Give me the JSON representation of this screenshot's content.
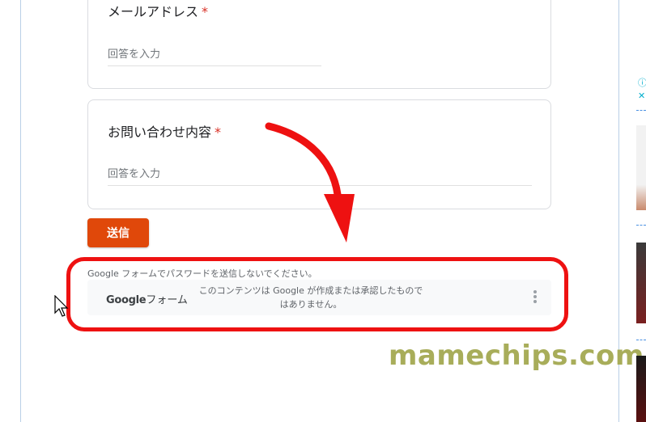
{
  "form": {
    "email_question": {
      "label": "メールアドレス",
      "required_mark": "*",
      "placeholder": "回答を入力"
    },
    "inquiry_question": {
      "label": "お問い合わせ内容",
      "required_mark": "*",
      "placeholder": "回答を入力"
    },
    "submit_label": "送信",
    "password_warning": "Google フォームでパスワードを送信しないでください。",
    "footer": {
      "brand_google": "Google",
      "brand_forms": "フォーム",
      "disclaimer_line1": "このコンテンツは Google が作成または承認したもので",
      "disclaimer_line2": "はありません。",
      "menu_icon": "more-vert-icon"
    }
  },
  "watermark": "mamechips.com",
  "sidebar": {
    "ad_info_icon": "ⓘ",
    "ad_close_icon": "✕"
  },
  "colors": {
    "submit": "#e0480a",
    "highlight": "#ee1111",
    "watermark": "#a8ad5a",
    "required": "#d93025"
  }
}
